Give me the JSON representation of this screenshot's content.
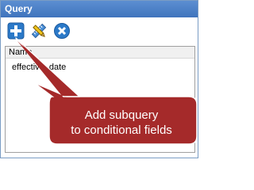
{
  "panel": {
    "title": "Query"
  },
  "toolbar": {
    "add_icon": "plus-icon",
    "edit_icon": "pencil-ruler-icon",
    "delete_icon": "close-circle-icon",
    "colors": {
      "add": "#2b79c8",
      "delete": "#2b79c8"
    }
  },
  "list": {
    "column_header": "Name",
    "items": [
      "effective_date"
    ]
  },
  "callout": {
    "line1": "Add subquery",
    "line2": "to conditional fields",
    "fill": "#a52a2a"
  }
}
